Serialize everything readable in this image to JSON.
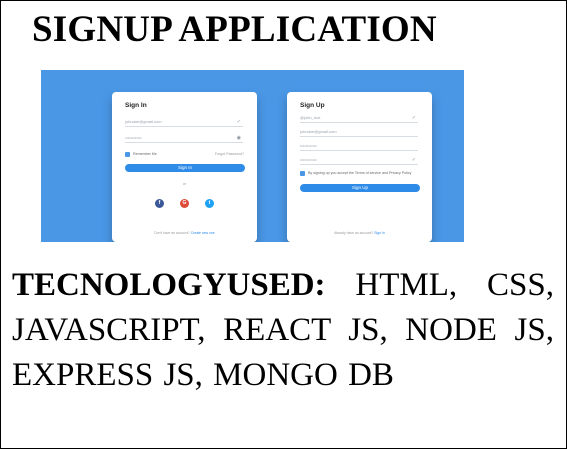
{
  "title": "SIGNUP APPLICATION",
  "screenshot": {
    "signin": {
      "title": "Sign In",
      "email_value": "johndoe@gmail.com",
      "password_value": "••••••••••••",
      "remember_label": "Remember Me",
      "forgot_label": "Forgot Password?",
      "button_label": "Sign In",
      "or_label": "or",
      "social": [
        {
          "name": "facebook-icon",
          "glyph": "f",
          "color": "#3b5998"
        },
        {
          "name": "google-icon",
          "glyph": "G",
          "color": "#dd4b39"
        },
        {
          "name": "twitter-icon",
          "glyph": "t",
          "color": "#1da1f2"
        }
      ],
      "footer_text": "Don't have an account? ",
      "footer_link": "Create new one"
    },
    "signup": {
      "title": "Sign Up",
      "username_value": "@john_doe",
      "email_value": "johndoe@gmail.com",
      "password_value": "••••••••••••",
      "confirm_value": "••••••••••••",
      "terms_text": "By signing up you accept the Terms of service and Privacy Policy",
      "button_label": "Sign Up",
      "footer_text": "Already have an account? ",
      "footer_link": "Sign In"
    },
    "accent_color": "#2f8be8",
    "background_color": "#4a97e6"
  },
  "technology": {
    "label": "TECNOLOGYUSED:",
    "list": "HTML, CSS, JAVASCRIPT, REACT JS, NODE JS, EXPRESS JS, MONGO DB"
  }
}
